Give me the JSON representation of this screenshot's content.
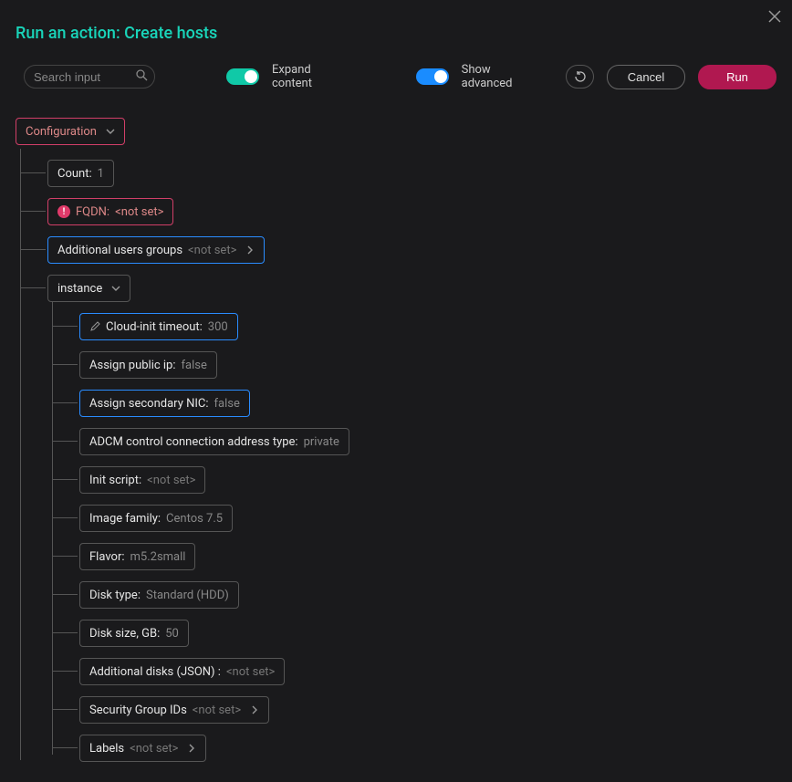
{
  "title": "Run an action: Create hosts",
  "search": {
    "placeholder": "Search input"
  },
  "toggles": {
    "expand": {
      "label": "Expand content",
      "on": true
    },
    "advanced": {
      "label": "Show advanced",
      "on": true
    }
  },
  "buttons": {
    "cancel": "Cancel",
    "run": "Run"
  },
  "tree": {
    "root": {
      "label": "Configuration"
    },
    "count": {
      "label": "Count:",
      "value": "1"
    },
    "fqdn": {
      "label": "FQDN:",
      "value": "<not set>"
    },
    "addGroups": {
      "label": "Additional users groups",
      "value": "<not set>"
    },
    "instance": {
      "label": "instance"
    },
    "cloudInit": {
      "label": "Cloud-init timeout:",
      "value": "300"
    },
    "publicIp": {
      "label": "Assign public ip:",
      "value": "false"
    },
    "secNic": {
      "label": "Assign secondary NIC:",
      "value": "false"
    },
    "adcm": {
      "label": "ADCM control connection address type:",
      "value": "private"
    },
    "initScript": {
      "label": "Init script:",
      "value": "<not set>"
    },
    "imageFamily": {
      "label": "Image family:",
      "value": "Centos 7.5"
    },
    "flavor": {
      "label": "Flavor:",
      "value": "m5.2small"
    },
    "diskType": {
      "label": "Disk type:",
      "value": "Standard (HDD)"
    },
    "diskSize": {
      "label": "Disk size, GB:",
      "value": "50"
    },
    "addDisks": {
      "label": "Additional disks (JSON) :",
      "value": "<not set>"
    },
    "secGroups": {
      "label": "Security Group IDs",
      "value": "<not set>"
    },
    "labels": {
      "label": "Labels",
      "value": "<not set>"
    }
  }
}
